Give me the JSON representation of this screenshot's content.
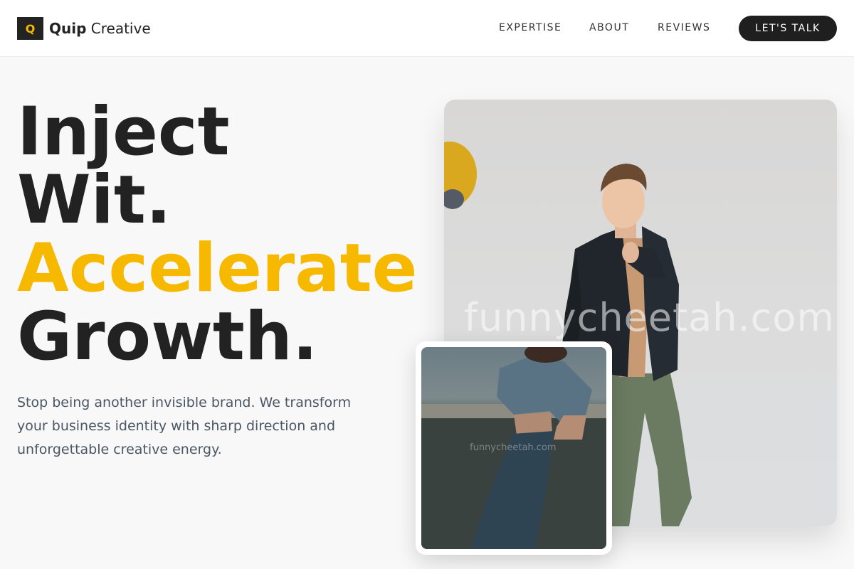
{
  "brand": {
    "mark": "Q",
    "name_bold": "Quip",
    "name_rest": "Creative"
  },
  "nav": {
    "items": [
      "EXPERTISE",
      "ABOUT",
      "REVIEWS"
    ],
    "cta": "LET'S TALK"
  },
  "hero": {
    "line1": "Inject",
    "line2": "Wit.",
    "line3": "Accelerate",
    "line4": "Growth.",
    "subtitle": "Stop being another invisible brand. We transform your business identity with sharp direction and unforgettable creative energy."
  },
  "images": {
    "main_watermark": "funnycheetah.com",
    "secondary_watermark": "funnycheetah.com"
  },
  "colors": {
    "accent": "#f7b900",
    "dark": "#1f1f1f",
    "background": "#f8f8f8"
  }
}
